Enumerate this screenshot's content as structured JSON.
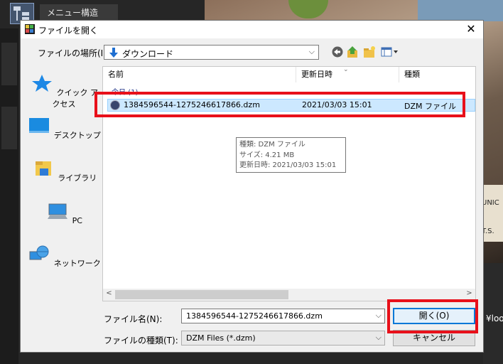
{
  "background": {
    "menu_tab": "メニュー構造",
    "side_text": "¥loop",
    "sign_top": "UNIC",
    "sign_bottom": "T.S."
  },
  "dialog": {
    "title": "ファイルを開く",
    "close_glyph": "✕",
    "location_label": "ファイルの場所(I):",
    "location_value": "ダウンロード",
    "places": [
      {
        "label": "クイック アクセス",
        "icon": "star-icon"
      },
      {
        "label": "デスクトップ",
        "icon": "desktop-icon"
      },
      {
        "label": "ライブラリ",
        "icon": "library-icon"
      },
      {
        "label": "PC",
        "icon": "pc-icon"
      },
      {
        "label": "ネットワーク",
        "icon": "network-icon"
      }
    ],
    "columns": [
      "名前",
      "更新日時",
      "種類"
    ],
    "group_label": "今日 (1)",
    "files": [
      {
        "name": "1384596544-1275246617866.dzm",
        "modified": "2021/03/03 15:01",
        "type": "DZM ファイル"
      }
    ],
    "tooltip": {
      "line1": "種類: DZM ファイル",
      "line2": "サイズ: 4.21 MB",
      "line3": "更新日時: 2021/03/03 15:01"
    },
    "filename_label": "ファイル名(N):",
    "filename_value": "1384596544-1275246617866.dzm",
    "filetype_label": "ファイルの種類(T):",
    "filetype_value": "DZM Files (*.dzm)",
    "open_button": "開く(O)",
    "cancel_button": "キャンセル"
  },
  "colors": {
    "highlight": "#e8101a",
    "selection": "#cce8ff",
    "default_button_border": "#0078d7"
  }
}
